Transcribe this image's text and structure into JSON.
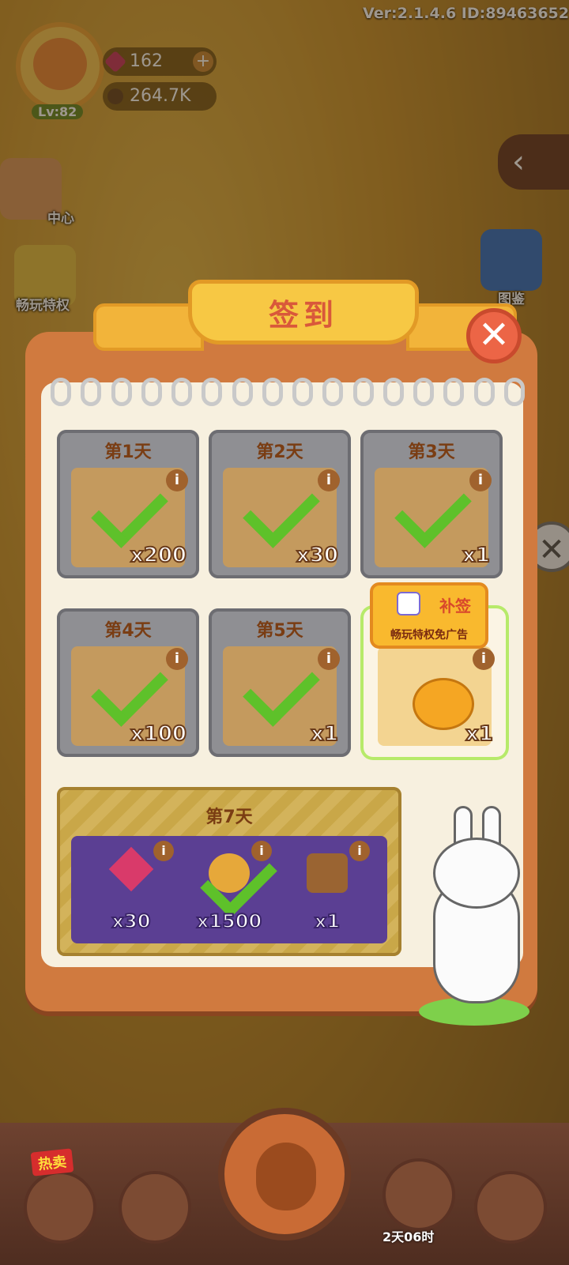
{
  "hud": {
    "version_text": "Ver:2.1.4.6 ID:89463652",
    "level": "Lv:82",
    "gems": "162",
    "coins": "264.7K",
    "plus": "+"
  },
  "side": {
    "vip_label": "畅玩特权",
    "center_label": "中心",
    "book_label": "图鉴",
    "back_glyph": "‹",
    "close_glyph": "✕"
  },
  "dialog": {
    "title": "签到",
    "close_glyph": "✕",
    "days": [
      {
        "label": "第1天",
        "qty": "x200",
        "claimed": true,
        "icon": "coin-icon"
      },
      {
        "label": "第2天",
        "qty": "x30",
        "claimed": true,
        "icon": "gem-icon"
      },
      {
        "label": "第3天",
        "qty": "x1",
        "claimed": true,
        "icon": "item-icon"
      },
      {
        "label": "第4天",
        "qty": "x100",
        "claimed": true,
        "icon": "card-icon"
      },
      {
        "label": "第5天",
        "qty": "x1",
        "claimed": true,
        "icon": "item-icon"
      },
      {
        "label": "",
        "qty": "x1",
        "claimed": false,
        "icon": "orange-icon"
      }
    ],
    "info_glyph": "i",
    "makeup": {
      "label": "补签",
      "subtitle": "畅玩特权免广告"
    },
    "day7": {
      "label": "第7天",
      "items": [
        {
          "qty": "x30",
          "icon": "gem-icon",
          "claimed": false
        },
        {
          "qty": "x1500",
          "icon": "coin-icon",
          "claimed": true
        },
        {
          "qty": "x1",
          "icon": "chest-icon",
          "claimed": false
        }
      ]
    }
  },
  "bottom": {
    "hot_label": "热卖",
    "timer": "2天06时"
  },
  "colors": {
    "check": "#5ec12a",
    "title": "#d9583a",
    "panel": "#d07a3f"
  }
}
